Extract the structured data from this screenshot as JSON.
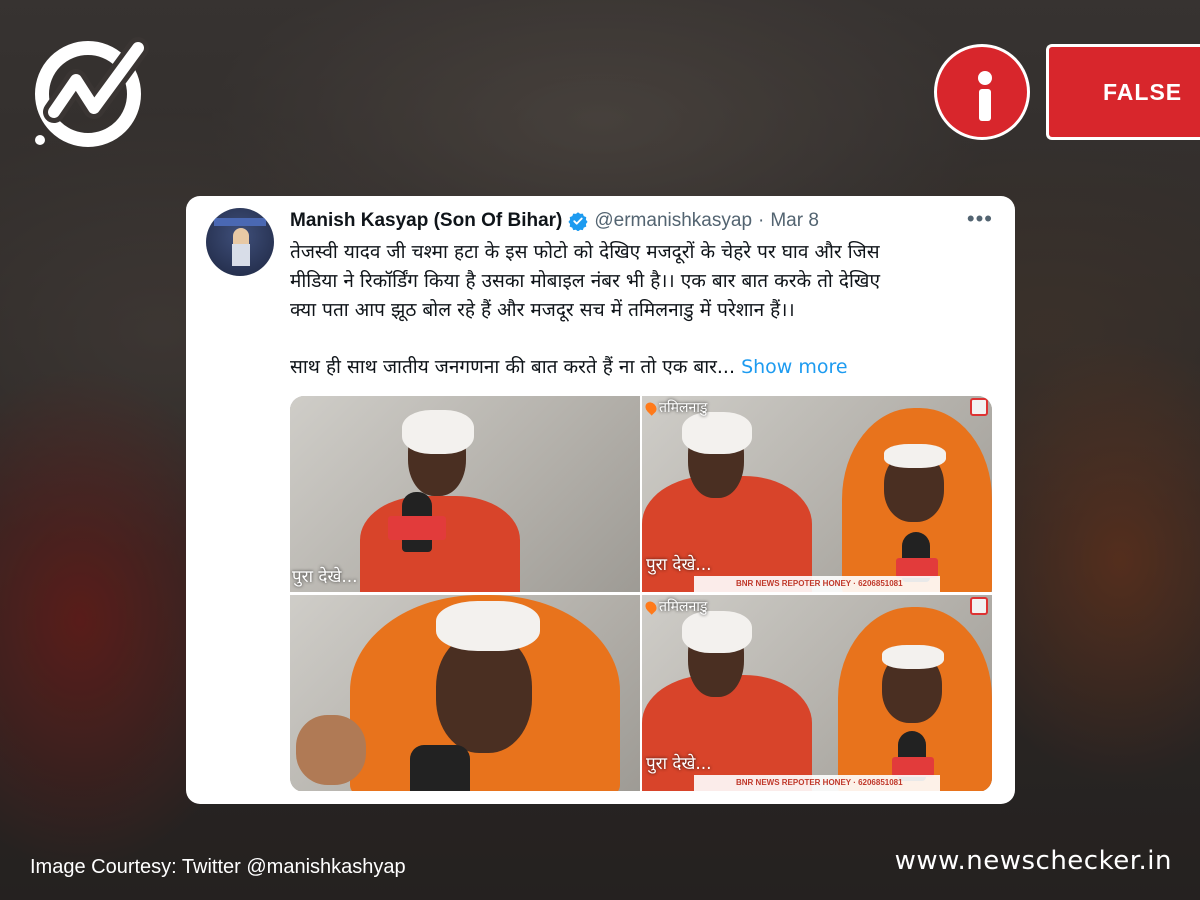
{
  "brand": {
    "logo_icon": "newschecker-checkmark-logo-icon"
  },
  "verdict": {
    "icon": "info-icon",
    "label": "FALSE",
    "color": "#d8262c"
  },
  "tweet": {
    "author_name": "Manish Kasyap (Son Of Bihar)",
    "handle": "@ermanishkasyap",
    "separator": "·",
    "date": "Mar 8",
    "more_icon": "•••",
    "verified_icon": "verified-badge-icon",
    "text_lines": [
      "तेजस्वी यादव जी चश्मा हटा के इस फोटो को देखिए मजदूरों के चेहरे पर घाव और जिस",
      "मीडिया ने रिकॉर्डिंग किया है उसका मोबाइल नंबर भी है।। एक बार बात करके तो देखिए",
      "क्या पता आप झूठ बोल रहे हैं और मजदूर सच में तमिलनाडु में परेशान हैं।।"
    ],
    "text_line_2": "साथ ही साथ जातीय जनगणना की बात करते हैं ना तो एक बार...",
    "show_more": "Show more",
    "link_color": "#1d9bf0",
    "media": [
      {
        "tag": "",
        "caption": "पुरा देखे..."
      },
      {
        "tag": "तमिलनाडु",
        "caption": "पुरा देखे...",
        "footer": "BNR NEWS REPOTER HONEY · 6206851081"
      },
      {
        "tag": "",
        "caption": ""
      },
      {
        "tag": "तमिलनाडु",
        "caption": "पुरा देखे...",
        "footer": "BNR NEWS REPOTER HONEY · 6206851081"
      }
    ]
  },
  "footer": {
    "courtesy": "Image Courtesy: Twitter @manishkashyap",
    "site": "www.newschecker.in"
  }
}
